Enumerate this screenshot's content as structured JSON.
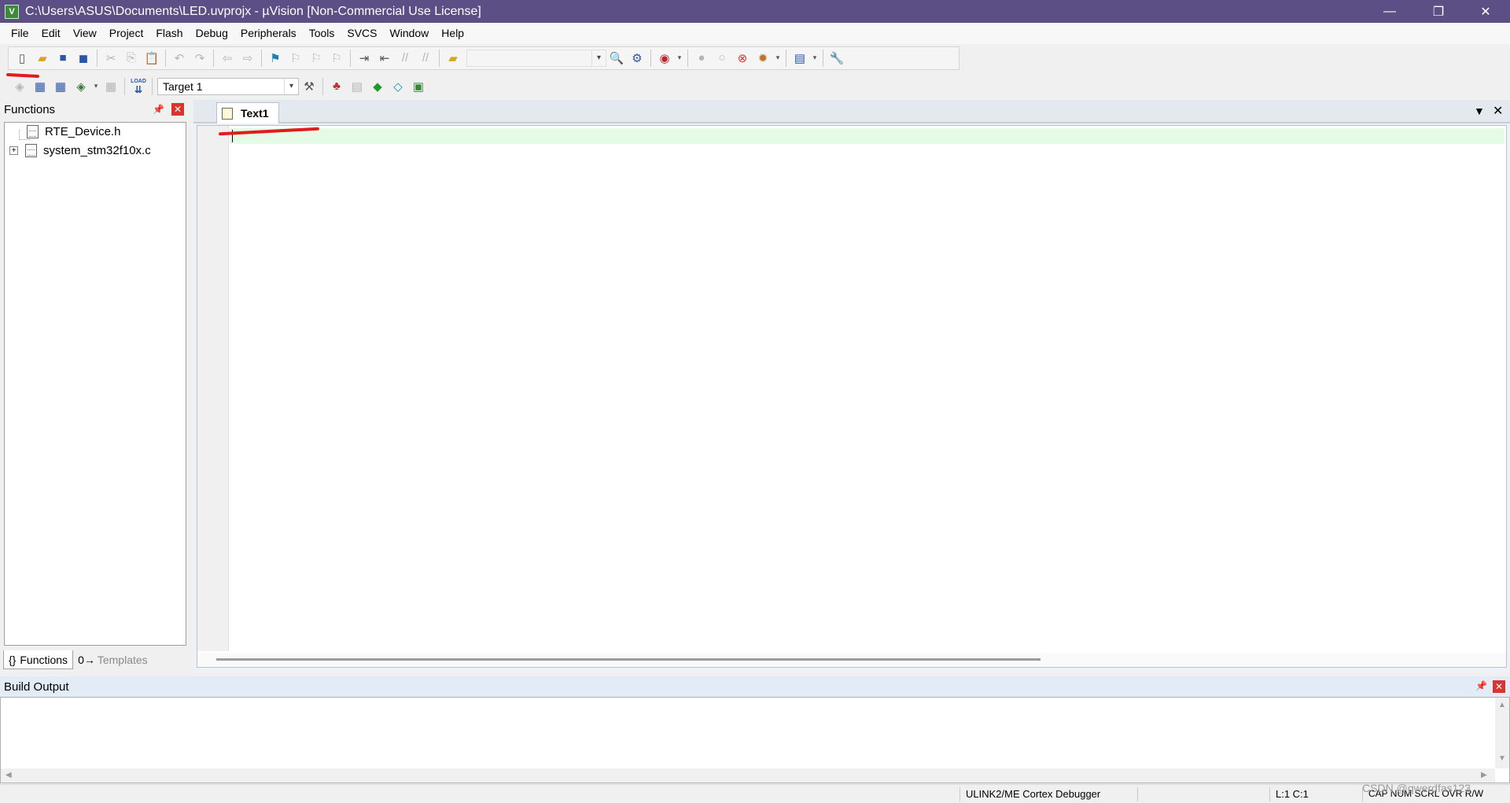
{
  "window": {
    "title": "C:\\Users\\ASUS\\Documents\\LED.uvprojx - µVision  [Non-Commercial Use License]",
    "app_icon_text": "V",
    "controls": {
      "minimize": "—",
      "restore": "❐",
      "close": "✕"
    }
  },
  "menu": [
    "File",
    "Edit",
    "View",
    "Project",
    "Flash",
    "Debug",
    "Peripherals",
    "Tools",
    "SVCS",
    "Window",
    "Help"
  ],
  "toolbar": {
    "row1_icons": [
      "new-file-icon",
      "open-folder-icon",
      "save-icon",
      "save-all-icon",
      "cut-icon",
      "copy-icon",
      "paste-icon",
      "undo-icon",
      "redo-icon",
      "navigate-back-icon",
      "navigate-forward-icon",
      "bookmark-icon",
      "prev-bookmark-icon",
      "next-bookmark-icon",
      "clear-bookmarks-icon",
      "indent-icon",
      "unindent-icon",
      "comment-icon",
      "uncomment-icon",
      "find-in-files-icon",
      "find-dropdown",
      "incremental-find-icon",
      "configure-icon",
      "debug-session-icon",
      "breakpoint-icon",
      "disable-breakpoint-icon",
      "kill-breakpoints-icon",
      "kill-all-breakpoints-icon",
      "window-layout-icon",
      "settings-wrench-icon"
    ],
    "row2_icons": [
      "translate-icon",
      "build-icon",
      "rebuild-icon",
      "batch-build-icon",
      "stop-build-icon",
      "download-icon",
      "target-options-icon",
      "manage-project-items-icon",
      "select-packs-icon",
      "manage-rte-icon",
      "pack-installer-icon"
    ],
    "load_label": "LOAD",
    "target_value": "Target 1"
  },
  "functions_panel": {
    "title": "Functions",
    "items": [
      {
        "label": "RTE_Device.h",
        "expandable": false
      },
      {
        "label": "system_stm32f10x.c",
        "expandable": true
      }
    ],
    "tabs": [
      {
        "icon": "{}",
        "label": "Functions",
        "active": true
      },
      {
        "icon": "0→",
        "label": "Templates",
        "active": false
      }
    ]
  },
  "editor": {
    "tabs": [
      {
        "label": "Text1",
        "active": true
      }
    ],
    "cursor": {
      "line": 1,
      "col": 1
    }
  },
  "build_output": {
    "title": "Build Output"
  },
  "status": {
    "debugger": "ULINK2/ME Cortex Debugger",
    "position": "L:1 C:1",
    "flags": "CAP  NUM  SCRL  OVR  R/W"
  },
  "watermark": "CSDN @qwerdfas123",
  "colors": {
    "titlebar": "#5b4f85",
    "current_line": "#e6fbe6",
    "annotation_red": "#e01c1c"
  }
}
